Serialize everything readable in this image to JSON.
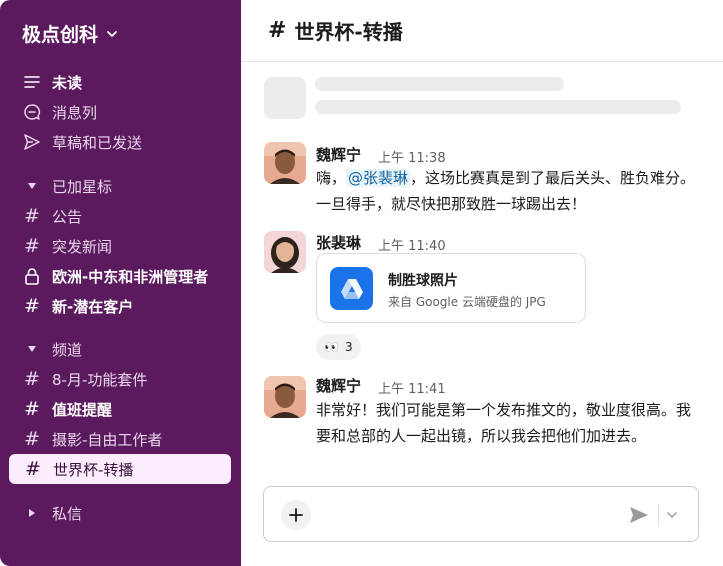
{
  "workspace": {
    "name": "极点创科"
  },
  "sidebar": {
    "top_items": [
      {
        "label": "未读",
        "icon": "unread-icon"
      },
      {
        "label": "消息列",
        "icon": "threads-icon"
      },
      {
        "label": "草稿和已发送",
        "icon": "send-icon"
      }
    ],
    "starred": {
      "label": "已加星标",
      "items": [
        {
          "label": "公告"
        },
        {
          "label": "突发新闻"
        },
        {
          "label": "欧洲-中东和非洲管理者"
        },
        {
          "label": "新-潜在客户"
        }
      ]
    },
    "channels": {
      "label": "频道",
      "items": [
        {
          "label": "8-月-功能套件"
        },
        {
          "label": "值班提醒"
        },
        {
          "label": "摄影-自由工作者"
        },
        {
          "label": "世界杯-转播"
        }
      ]
    },
    "dms": {
      "label": "私信"
    }
  },
  "header": {
    "channel": "世界杯-转播"
  },
  "messages": [
    {
      "author": "魏辉宁",
      "time": "上午 11:38",
      "text_before": "嗨，",
      "mention": "@张裴琳",
      "text_after": "，这场比赛真是到了最后关头、胜负难分。一旦得手，就尽快把那致胜一球踢出去！"
    },
    {
      "author": "张裴琳",
      "time": "上午 11:40",
      "file": {
        "name": "制胜球照片",
        "source": "来自 Google 云端硬盘的 JPG"
      },
      "reaction": {
        "emoji": "👀",
        "count": "3"
      }
    },
    {
      "author": "魏辉宁",
      "time": "上午 11:41",
      "text": "非常好！我们可能是第一个发布推文的，敬业度很高。我要和总部的人一起出镜，所以我会把他们加进去。"
    }
  ],
  "colors": {
    "sidebar_bg": "#5b1a5e",
    "active_item_bg": "#fcedfc",
    "mention": "#1264a3",
    "drive_blue": "#1a73e8"
  }
}
